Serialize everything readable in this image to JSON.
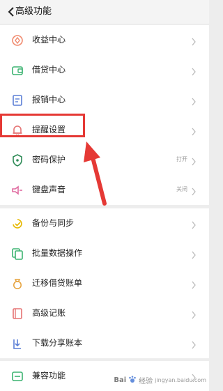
{
  "header": {
    "title": "高级功能"
  },
  "group1": [
    {
      "label": "收益中心",
      "value": ""
    },
    {
      "label": "借贷中心",
      "value": ""
    },
    {
      "label": "报销中心",
      "value": ""
    },
    {
      "label": "提醒设置",
      "value": ""
    },
    {
      "label": "密码保护",
      "value": "打开"
    },
    {
      "label": "键盘声音",
      "value": "关闭"
    }
  ],
  "group2": [
    {
      "label": "备份与同步"
    },
    {
      "label": "批量数据操作"
    },
    {
      "label": "迁移借贷账单"
    },
    {
      "label": "高级记账"
    },
    {
      "label": "下载分享账本"
    }
  ],
  "group3": [
    {
      "label": "兼容功能"
    }
  ],
  "watermark": {
    "brand": "Bai",
    "suffix": "经验",
    "site": "jingyan.baidu.com"
  },
  "colors": {
    "highlight": "#e53935",
    "background": "#ededed",
    "card": "#ffffff"
  },
  "icons": {
    "group1": [
      "income-icon",
      "loan-icon",
      "reimburse-icon",
      "bell-icon",
      "shield-icon",
      "speaker-icon"
    ],
    "group2": [
      "backup-icon",
      "batch-icon",
      "money-bag-icon",
      "advanced-icon",
      "download-icon"
    ],
    "group3": [
      "compat-icon"
    ]
  }
}
